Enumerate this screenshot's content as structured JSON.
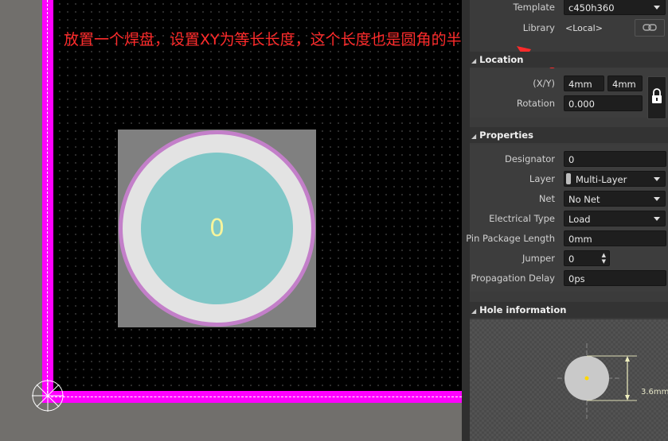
{
  "canvas": {
    "pad_designator": "0",
    "annotation_text": "放置一个焊盘，设置XY为等长长度，这个长度也是圆角的半径"
  },
  "panel": {
    "template": {
      "label": "Template",
      "value": "c450h360"
    },
    "library": {
      "label": "Library",
      "value": "<Local>"
    },
    "location": {
      "title": "Location",
      "xy_label": "(X/Y)",
      "x_value": "4mm",
      "y_value": "4mm",
      "rotation_label": "Rotation",
      "rotation_value": "0.000"
    },
    "properties": {
      "title": "Properties",
      "designator": {
        "label": "Designator",
        "value": "0"
      },
      "layer": {
        "label": "Layer",
        "value": "Multi-Layer"
      },
      "net": {
        "label": "Net",
        "value": "No Net"
      },
      "electrical_type": {
        "label": "Electrical Type",
        "value": "Load"
      },
      "pin_package_length": {
        "label": "Pin Package Length",
        "value": "0mm"
      },
      "jumper": {
        "label": "Jumper",
        "value": "0"
      },
      "propagation_delay": {
        "label": "Propagation Delay",
        "value": "0ps"
      }
    },
    "hole_information": {
      "title": "Hole information",
      "dimension_text": "3.6mm"
    }
  },
  "colors": {
    "board_outline": "#ff00ff",
    "pad_copper": "#808080",
    "pad_ring": "#c37fc9",
    "hole": "#7fc7c7",
    "annotation": "#ff2b2b"
  }
}
